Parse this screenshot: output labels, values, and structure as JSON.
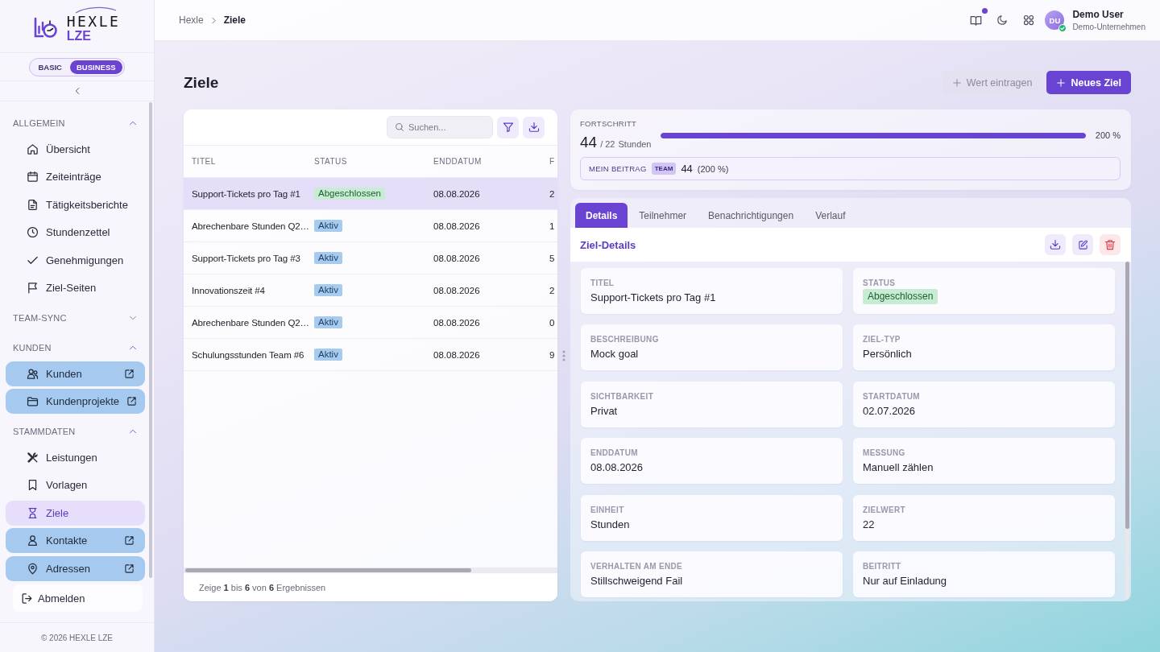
{
  "sidebar": {
    "logo": {
      "wordmark": "HEXLE",
      "subtitle": "LZE"
    },
    "plan_toggle": [
      {
        "label": "BASIC",
        "selected": false
      },
      {
        "label": "BUSINESS",
        "selected": true
      }
    ],
    "sections": [
      {
        "title": "ALLGEMEIN",
        "expanded": true,
        "items": [
          {
            "label": "Übersicht",
            "selected": false,
            "external": false
          },
          {
            "label": "Zeiteinträge",
            "selected": false,
            "external": false
          },
          {
            "label": "Tätigkeitsberichte",
            "selected": false,
            "external": false
          },
          {
            "label": "Stundenzettel",
            "selected": false,
            "external": false
          },
          {
            "label": "Genehmigungen",
            "selected": false,
            "external": false
          },
          {
            "label": "Ziel-Seiten",
            "selected": false,
            "external": false
          }
        ]
      },
      {
        "title": "TEAM-SYNC",
        "expanded": false
      },
      {
        "title": "KUNDEN",
        "expanded": true,
        "items": [
          {
            "label": "Kunden",
            "selected": false,
            "external": true
          },
          {
            "label": "Kundenprojekte",
            "selected": false,
            "external": true
          }
        ]
      },
      {
        "title": "STAMMDATEN",
        "expanded": true,
        "items": [
          {
            "label": "Leistungen",
            "selected": false,
            "external": false
          },
          {
            "label": "Vorlagen",
            "selected": false,
            "external": false
          },
          {
            "label": "Ziele",
            "selected": true,
            "external": false
          },
          {
            "label": "Kontakte",
            "selected": false,
            "external": true
          },
          {
            "label": "Adressen",
            "selected": false,
            "external": true
          }
        ]
      }
    ],
    "logout": "Abmelden",
    "footer": "© 2026 HEXLE LZE"
  },
  "header": {
    "breadcrumb": [
      {
        "label": "Hexle",
        "current": false
      },
      {
        "label": "Ziele",
        "current": true
      }
    ],
    "notification_dot": true,
    "user": {
      "initials": "DU",
      "name": "Demo User",
      "company": "Demo-Unternehmen",
      "online": true
    }
  },
  "page": {
    "title": "Ziele",
    "actions": [
      {
        "label": "Wert eintragen",
        "disabled": true
      },
      {
        "label": "Neues Ziel",
        "disabled": false
      }
    ]
  },
  "goals_table": {
    "search": {
      "placeholder": "Suchen..."
    },
    "columns": [
      "TITEL",
      "STATUS",
      "ENDDATUM",
      "F"
    ],
    "rows": [
      {
        "title": "Support-Tickets pro Tag #1",
        "status": {
          "label": "Abgeschlossen",
          "color": "#c8ecd3"
        },
        "end_date": "08.08.2026",
        "column_4": "2",
        "selected": true
      },
      {
        "title": "Abrechenbare Stunden Q2…",
        "status": {
          "label": "Aktiv",
          "color": "#a7cbef"
        },
        "end_date": "08.08.2026",
        "column_4": "1",
        "selected": false
      },
      {
        "title": "Support-Tickets pro Tag #3",
        "status": {
          "label": "Aktiv",
          "color": "#a7cbef"
        },
        "end_date": "08.08.2026",
        "column_4": "5",
        "selected": false
      },
      {
        "title": "Innovationszeit #4",
        "status": {
          "label": "Aktiv",
          "color": "#a7cbef"
        },
        "end_date": "08.08.2026",
        "column_4": "2",
        "selected": false
      },
      {
        "title": "Abrechenbare Stunden Q2…",
        "status": {
          "label": "Aktiv",
          "color": "#a7cbef"
        },
        "end_date": "08.08.2026",
        "column_4": "0",
        "selected": false
      },
      {
        "title": "Schulungsstunden Team #6",
        "status": {
          "label": "Aktiv",
          "color": "#a7cbef"
        },
        "end_date": "08.08.2026",
        "column_4": "9",
        "selected": false
      }
    ],
    "footer": "Zeige **1** bis **6** von **6** Ergebnissen"
  },
  "progress": {
    "label": "FORTSCHRITT",
    "current": "44",
    "target": "/ 22",
    "unit": "Stunden",
    "level": 1,
    "reading": "200 %",
    "contribution": {
      "label": "MEIN BEITRAG",
      "badge": "TEAM",
      "value": "44",
      "percent": "(200 %)"
    }
  },
  "details": {
    "tabs": [
      {
        "label": "Details",
        "selected": true
      },
      {
        "label": "Teilnehmer",
        "selected": false
      },
      {
        "label": "Benachrichtigungen",
        "selected": false
      },
      {
        "label": "Verlauf",
        "selected": false
      }
    ],
    "title": "Ziel-Details",
    "fields": [
      {
        "label": "TITEL",
        "value": "Support-Tickets pro Tag #1",
        "kind": "text"
      },
      {
        "label": "STATUS",
        "value": "Abgeschlossen",
        "kind": "badge",
        "color": "#c8ecd3"
      },
      {
        "label": "BESCHREIBUNG",
        "value": "Mock goal",
        "kind": "text"
      },
      {
        "label": "ZIEL-TYP",
        "value": "Persönlich",
        "kind": "text"
      },
      {
        "label": "SICHTBARKEIT",
        "value": "Privat",
        "kind": "text"
      },
      {
        "label": "STARTDATUM",
        "value": "02.07.2026",
        "kind": "text"
      },
      {
        "label": "ENDDATUM",
        "value": "08.08.2026",
        "kind": "text"
      },
      {
        "label": "MESSUNG",
        "value": "Manuell zählen",
        "kind": "text"
      },
      {
        "label": "EINHEIT",
        "value": "Stunden",
        "kind": "text"
      },
      {
        "label": "ZIELWERT",
        "value": "22",
        "kind": "text"
      },
      {
        "label": "VERHALTEN AM ENDE",
        "value": "Stillschweigend Fail",
        "kind": "text"
      },
      {
        "label": "BEITRITT",
        "value": "Nur auf Einladung",
        "kind": "text"
      }
    ]
  }
}
